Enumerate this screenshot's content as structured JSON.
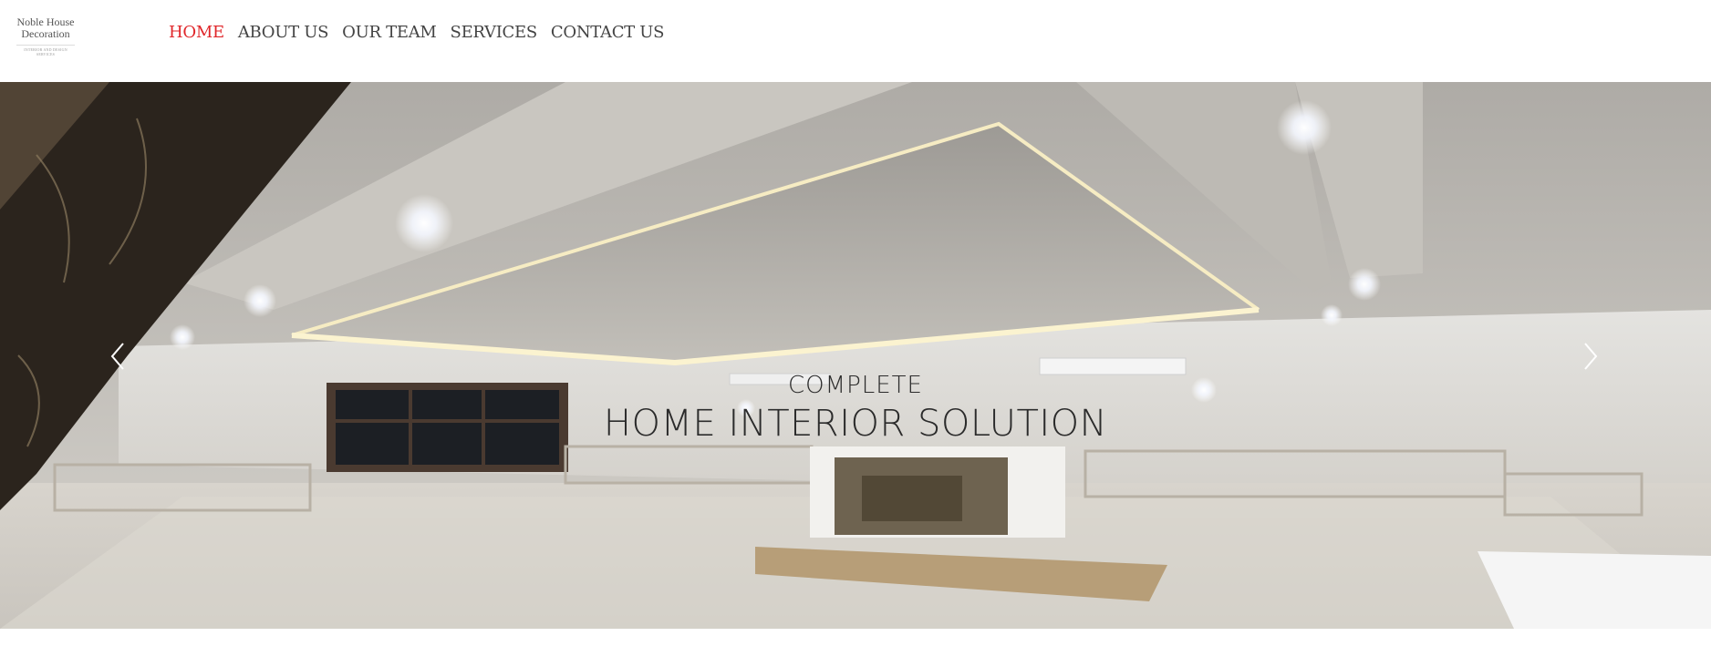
{
  "brand": {
    "line1": "Noble House",
    "line2": "Decoration",
    "tagline": "INTERIOR AND DESIGN SERVICES"
  },
  "nav": {
    "items": [
      {
        "label": "HOME",
        "active": true
      },
      {
        "label": "ABOUT US",
        "active": false
      },
      {
        "label": "OUR TEAM",
        "active": false
      },
      {
        "label": "SERVICES",
        "active": false
      },
      {
        "label": "CONTACT US",
        "active": false
      }
    ],
    "active_color": "#e0262a"
  },
  "hero": {
    "caption_small": "COMPLETE",
    "caption_large": "HOME INTERIOR SOLUTION",
    "prev_icon": "chevron-left-icon",
    "next_icon": "chevron-right-icon"
  }
}
